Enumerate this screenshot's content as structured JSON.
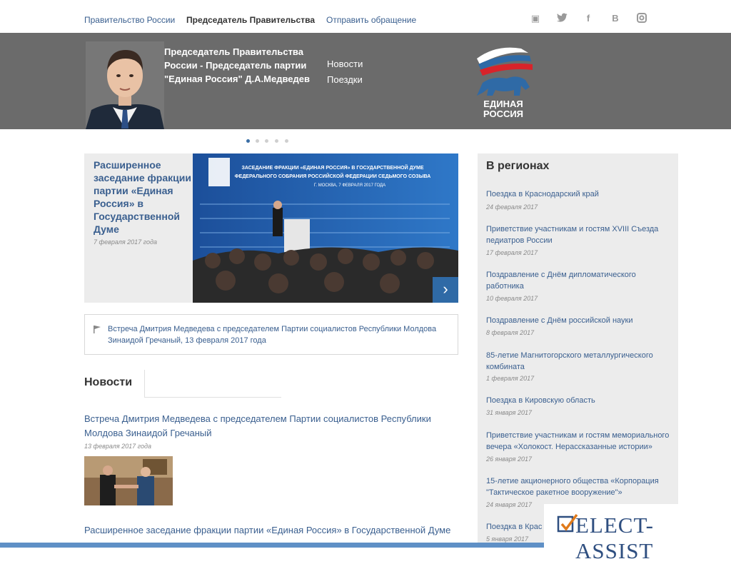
{
  "topnav": {
    "items": [
      "Правительство России",
      "Председатель Правительства",
      "Отправить обращение"
    ],
    "active": "Председатель Правительства",
    "social": [
      {
        "icon": "youtube-icon",
        "glyph": "▣"
      },
      {
        "icon": "twitter-icon",
        "glyph": "🐦"
      },
      {
        "icon": "facebook-icon",
        "glyph": "f"
      },
      {
        "icon": "vk-icon",
        "glyph": "B"
      },
      {
        "icon": "instagram-icon",
        "glyph": "◙"
      }
    ]
  },
  "hero": {
    "title": "Председатель Правительства России - Председатель партии \"Единая Россия\" Д.А.Медведев",
    "links": [
      "Новости",
      "Поездки"
    ],
    "logo_text": [
      "ЕДИНАЯ",
      "РОССИЯ"
    ]
  },
  "feature": {
    "title": "Расширенное заседание фракции партии «Единая Россия» в Государственной Думе",
    "date": "7 февраля 2017 года",
    "banner": [
      "ЗАСЕДАНИЕ ФРАКЦИИ «ЕДИНАЯ РОССИЯ» В ГОСУДАРСТВЕННОЙ ДУМЕ",
      "ФЕДЕРАЛЬНОГО СОБРАНИЯ РОССИЙСКОЙ ФЕДЕРАЦИИ СЕДЬМОГО СОЗЫВА",
      "Г. МОСКВА, 7 ФЕВРАЛЯ 2017 ГОДА"
    ],
    "next_glyph": "›"
  },
  "notice": {
    "text": "Встреча Дмитрия Медведева с председателем Партии социалистов Республики Молдова Зинаидой Гречаный, 13 февраля 2017 года"
  },
  "news": {
    "heading": "Новости",
    "items": [
      {
        "title": "Встреча Дмитрия Медведева с председателем Партии социалистов Республики Молдова Зинаидой Гречаный",
        "date": "13 февраля 2017 года"
      },
      {
        "title": "Расширенное заседание фракции партии «Единая Россия» в Государственной Думе"
      }
    ]
  },
  "sidebar": {
    "heading": "В регионах",
    "items": [
      {
        "title": "Поездка в Краснодарский край",
        "date": "24 февраля 2017"
      },
      {
        "title": "Приветствие участникам и гостям XVIII Съезда педиатров России",
        "date": "17 февраля 2017"
      },
      {
        "title": "Поздравление с Днём дипломатического работника",
        "date": "10 февраля 2017"
      },
      {
        "title": "Поздравление с Днём российской науки",
        "date": "8 февраля 2017"
      },
      {
        "title": "85-летие Магнитогорского металлургического комбината",
        "date": "1 февраля 2017"
      },
      {
        "title": "Поездка в Кировскую область",
        "date": "31 января 2017"
      },
      {
        "title": "Приветствие участникам и гостям мемориального вечера «Холокост. Нерассказанные истории»",
        "date": "26 января 2017"
      },
      {
        "title": "15-летие акционерного общества «Корпорация \"Тактическое ракетное вооружение\"»",
        "date": "24 января 2017"
      },
      {
        "title": "Поездка в Крас",
        "date": "5 января 2017"
      }
    ]
  },
  "watermark": {
    "text": "ELECT-ASSIST",
    "icon": "checkbox-icon"
  },
  "colors": {
    "link": "#3a5f8f",
    "hero_bg": "#6b6b6b",
    "accent": "#2f6aa6",
    "sidebar_bg": "#ececec"
  }
}
